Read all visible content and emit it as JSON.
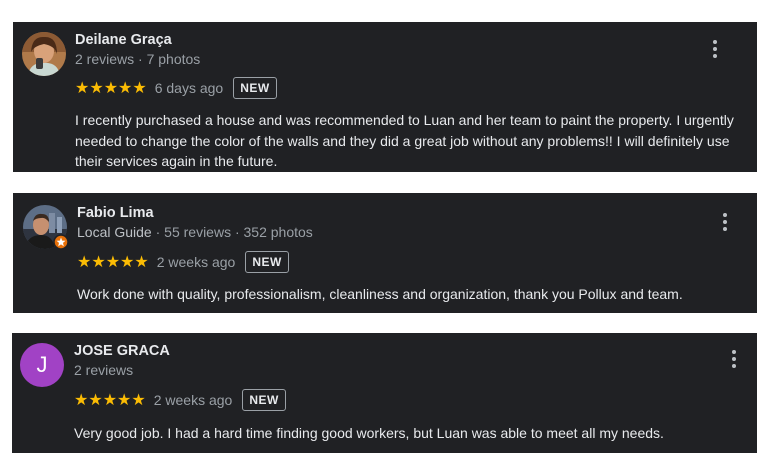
{
  "reviews": [
    {
      "name": "Deilane Graça",
      "local_guide": "",
      "stats": "2 reviews · 7 photos",
      "rating": 5,
      "stars": "★★★★★",
      "time": "6 days ago",
      "badge": "NEW",
      "text": "I recently purchased a house and was recommended to Luan and her team to paint the property. I urgently needed to change the color of the walls and they did a great job without any problems!! I will definitely use their services again in the future."
    },
    {
      "name": "Fabio Lima",
      "local_guide": "Local Guide",
      "stats": " · 55 reviews · 352 photos",
      "rating": 5,
      "stars": "★★★★★",
      "time": "2 weeks ago",
      "badge": "NEW",
      "text": "Work done with quality, professionalism, cleanliness and organization, thank you Pollux and team."
    },
    {
      "name": "JOSE GRACA",
      "local_guide": "",
      "stats": "2 reviews",
      "rating": 5,
      "stars": "★★★★★",
      "time": "2 weeks ago",
      "badge": "NEW",
      "text": "Very good job. I had a hard time finding good workers, but Luan was able to meet all my needs.",
      "avatar_letter": "J",
      "avatar_color": "#a142c5"
    }
  ],
  "colors": {
    "card_background": "#202124",
    "star": "#fbbc04",
    "text_primary": "#e8eaed",
    "text_secondary": "#9aa0a6"
  }
}
